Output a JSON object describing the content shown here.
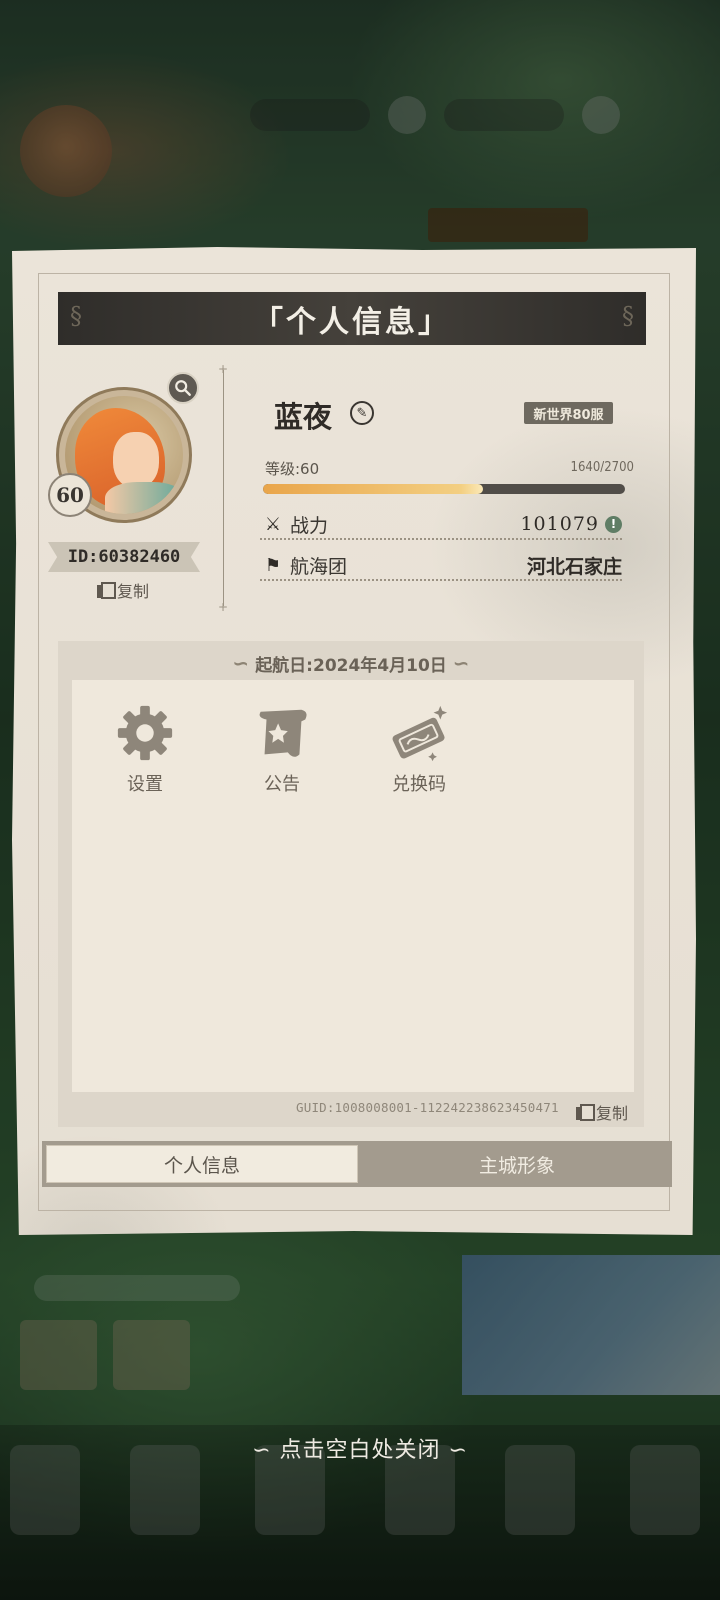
{
  "dialog": {
    "title": "「个人信息」",
    "close_hint": "∽ 点击空白处关闭 ∽"
  },
  "profile": {
    "level_badge": "60",
    "id_text": "ID:60382460",
    "copy_label": "复制",
    "name": "蓝夜",
    "server": "新世界80服",
    "level_label": "等级:60",
    "exp_text": "1640/2700",
    "exp_progress": 0.607,
    "power_label": "战力",
    "power_value": "101079",
    "crew_label": "航海团",
    "crew_value": "河北石家庄"
  },
  "sail": {
    "date_text": "起航日:2024年4月10日"
  },
  "functions": [
    {
      "label": "设置",
      "icon": "gear-icon"
    },
    {
      "label": "公告",
      "icon": "scroll-icon"
    },
    {
      "label": "兑换码",
      "icon": "ticket-icon"
    }
  ],
  "guid": {
    "text": "GUID:1008008001-112242238623450471",
    "copy_label": "复制"
  },
  "tabs": [
    {
      "label": "个人信息",
      "active": true
    },
    {
      "label": "主城形象",
      "active": false
    }
  ],
  "colors": {
    "paper": "#e6dfd3",
    "header": "#3a3733",
    "exp_fill": "#e9a54a",
    "tab_inactive": "#a39b8e"
  }
}
